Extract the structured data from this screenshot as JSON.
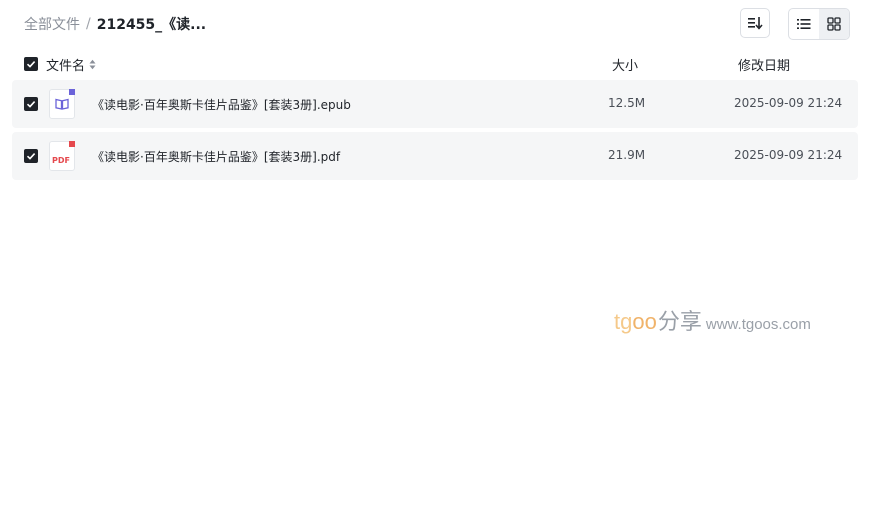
{
  "breadcrumb": {
    "root": "全部文件",
    "separator": "/",
    "current": "212455_《读..."
  },
  "toolbar": {
    "sort_icon": "sort-icon",
    "list_view_icon": "list-view-icon",
    "grid_view_icon": "grid-view-icon",
    "active_view": "list"
  },
  "table": {
    "headers": {
      "name": "文件名",
      "size": "大小",
      "date": "修改日期"
    },
    "rows": [
      {
        "name": "《读电影·百年奥斯卡佳片品鉴》[套装3册].epub",
        "size": "12.5M",
        "date": "2025-09-09 21:24",
        "type": "epub",
        "checked": true
      },
      {
        "name": "《读电影·百年奥斯卡佳片品鉴》[套装3册].pdf",
        "size": "21.9M",
        "date": "2025-09-09 21:24",
        "type": "pdf",
        "icon_text": "PDF",
        "checked": true
      }
    ]
  },
  "watermark": {
    "brand_part1": "tg",
    "brand_part2": "oo",
    "share": "分享",
    "url": "www.tgoos.com"
  },
  "colors": {
    "text": "#1f2329",
    "muted": "#8a8f99",
    "row_bg": "#f5f6f7",
    "epub_accent": "#6b63d9",
    "pdf_accent": "#e5484d",
    "watermark_gold": "#f0b36a",
    "watermark_gray": "#9aa0a8"
  }
}
